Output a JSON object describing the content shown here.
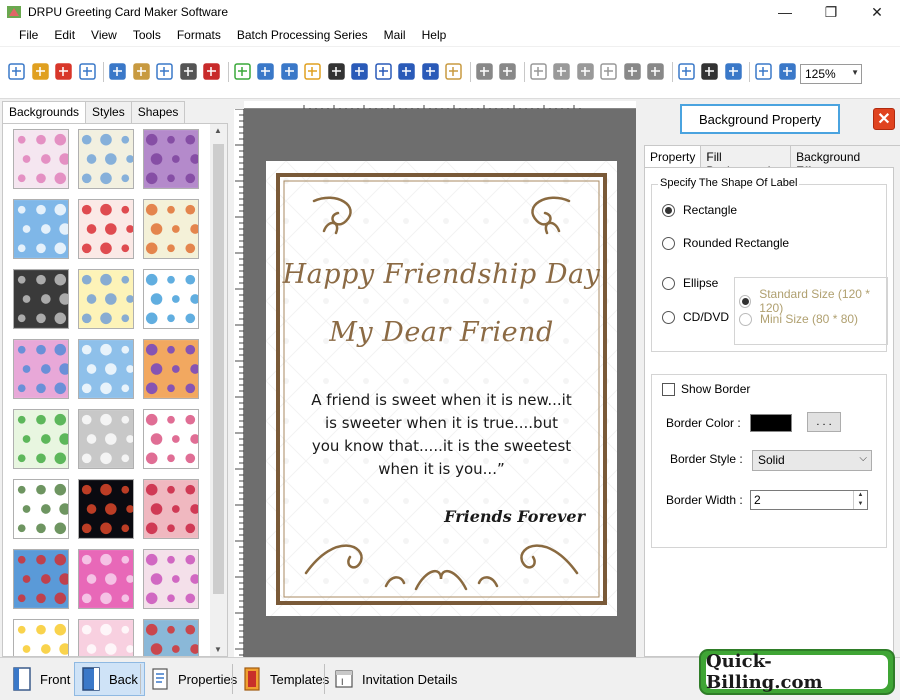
{
  "window": {
    "title": "DRPU Greeting Card Maker Software",
    "minimize": "—",
    "maximize": "❐",
    "close": "✕"
  },
  "menu": [
    "File",
    "Edit",
    "View",
    "Tools",
    "Formats",
    "Batch Processing Series",
    "Mail",
    "Help"
  ],
  "toolbar": {
    "zoom_value": "125%",
    "icons": [
      "new-icon",
      "open-icon",
      "close-doc-icon",
      "save-icon",
      "save-as-icon",
      "export-icon",
      "print-preview-icon",
      "print-icon",
      "layers-icon",
      "crop-icon",
      "image-icon",
      "pen-icon",
      "picture-icon",
      "barcode-icon",
      "text-icon",
      "font-icon",
      "signature-icon",
      "line-icon",
      "database-icon",
      "undo-icon",
      "redo-icon",
      "copy-icon",
      "paste-icon",
      "cut-icon",
      "delete-icon",
      "bring-forward-icon",
      "send-backward-icon",
      "grid-icon",
      "actual-size-icon",
      "fit-icon",
      "zoom-in-icon",
      "zoom-out-icon"
    ]
  },
  "left_panel": {
    "tabs": [
      "Backgrounds",
      "Styles",
      "Shapes"
    ],
    "active_tab": "Backgrounds",
    "thumbnails": [
      {
        "name": "bg-thumb-baby-toys",
        "color": "#f5e6f0",
        "accent": "#e07ab8"
      },
      {
        "name": "bg-thumb-baby-letters",
        "color": "#f2f0e0",
        "accent": "#6aa0d8"
      },
      {
        "name": "bg-thumb-purple-pattern",
        "color": "#b48acb",
        "accent": "#7a3e9b"
      },
      {
        "name": "bg-thumb-clouds",
        "color": "#7fb7e8",
        "accent": "#ffffff"
      },
      {
        "name": "bg-thumb-strawberries",
        "color": "#fbe9e6",
        "accent": "#d8232a"
      },
      {
        "name": "bg-thumb-leaves",
        "color": "#f4f1d8",
        "accent": "#e06a2a"
      },
      {
        "name": "bg-thumb-grey-leaves",
        "color": "#3a3a3a",
        "accent": "#c8c8c8"
      },
      {
        "name": "bg-thumb-dots-yellow",
        "color": "#fdf3b8",
        "accent": "#6a9ad8"
      },
      {
        "name": "bg-thumb-gifts",
        "color": "#ffffff",
        "accent": "#3a9ad8"
      },
      {
        "name": "bg-thumb-pink-swirls",
        "color": "#e8a8d8",
        "accent": "#4a8ad8"
      },
      {
        "name": "bg-thumb-snowflakes",
        "color": "#8ec0ea",
        "accent": "#ffffff"
      },
      {
        "name": "bg-thumb-colorful-flowers",
        "color": "#f2a860",
        "accent": "#6a3ec8"
      },
      {
        "name": "bg-thumb-green-trees",
        "color": "#e8f6e0",
        "accent": "#3aa83a"
      },
      {
        "name": "bg-thumb-white-heart",
        "color": "#c8c8c8",
        "accent": "#ffffff"
      },
      {
        "name": "bg-thumb-doodles",
        "color": "#ffffff",
        "accent": "#d84a7a"
      },
      {
        "name": "bg-thumb-ornament",
        "color": "#ffffff",
        "accent": "#4a7a3a"
      },
      {
        "name": "bg-thumb-fireworks",
        "color": "#0a0a10",
        "accent": "#e84a2a"
      },
      {
        "name": "bg-thumb-hearts",
        "color": "#f0b8c0",
        "accent": "#c81a3a"
      },
      {
        "name": "bg-thumb-christmas",
        "color": "#5a9ad8",
        "accent": "#d82a2a"
      },
      {
        "name": "bg-thumb-pink-circles",
        "color": "#e868b8",
        "accent": "#f8d8f0"
      },
      {
        "name": "bg-thumb-pink-flowers",
        "color": "#f4e0ea",
        "accent": "#c84ab8"
      },
      {
        "name": "bg-thumb-stars",
        "color": "#ffffff",
        "accent": "#f8c820"
      },
      {
        "name": "bg-thumb-pink-lace",
        "color": "#f8d0e0",
        "accent": "#ffffff"
      },
      {
        "name": "bg-thumb-snowmen",
        "color": "#8ab8d8",
        "accent": "#d82a2a"
      }
    ]
  },
  "card": {
    "line1": "Happy Friendship Day",
    "line2": "My Dear Friend",
    "poem": [
      "A friend is sweet when it is new...it",
      "is sweeter when it is true....but",
      "you know that.....it is the sweetest",
      "when it is you...”"
    ],
    "signoff": "Friends Forever",
    "text_color": "#8b6a44",
    "border_color": "#7a5a38"
  },
  "right_panel": {
    "title": "Background Property",
    "close_label": "✕",
    "tabs": [
      "Property",
      "Fill Background",
      "Background Effects"
    ],
    "active_tab": "Property",
    "shape_group_label": "Specify The Shape Of Label",
    "shapes": {
      "rectangle": "Rectangle",
      "rounded": "Rounded Rectangle",
      "ellipse": "Ellipse",
      "cddvd": "CD/DVD"
    },
    "selected_shape": "Rectangle",
    "sizes": {
      "standard": "Standard Size (120 * 120)",
      "mini": "Mini Size (80 * 80)"
    },
    "show_border_label": "Show Border",
    "border_color_label": "Border Color :",
    "border_color_value": "#000000",
    "dots_label": ". . .",
    "border_style_label": "Border Style :",
    "border_style_value": "Solid",
    "border_width_label": "Border Width :",
    "border_width_value": "2"
  },
  "bottom_bar": {
    "front": "Front",
    "back": "Back",
    "properties": "Properties",
    "templates": "Templates",
    "invitation": "Invitation Details",
    "brand": "Quick-Billing.com"
  }
}
